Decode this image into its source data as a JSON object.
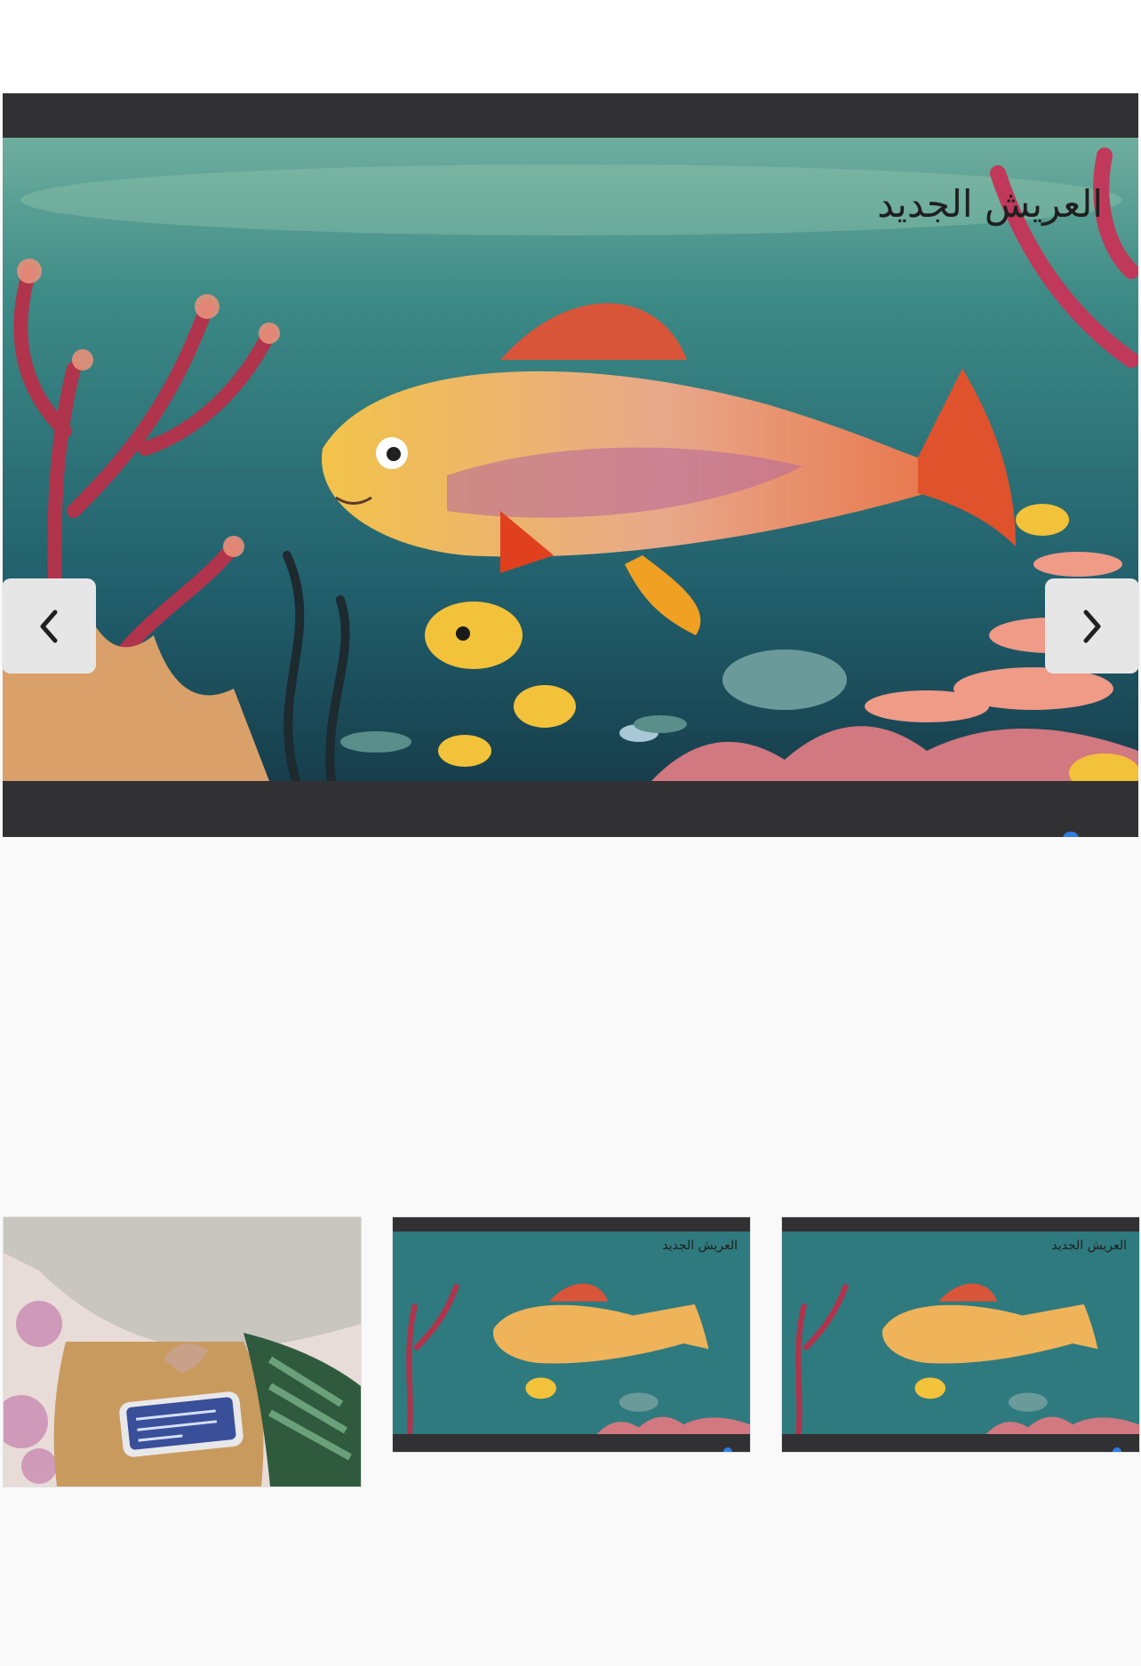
{
  "viewer": {
    "main_caption": "العريش الجديد",
    "prev_icon": "chevron-left-icon",
    "next_icon": "chevron-right-icon"
  },
  "thumbnails": [
    {
      "kind": "photo",
      "subject": "phone-on-table"
    },
    {
      "kind": "illustration",
      "caption": "العريش الجديد"
    },
    {
      "kind": "illustration",
      "caption": "العريش الجديد"
    }
  ],
  "colors": {
    "viewer_frame": "#313133",
    "nav_button": "#e6e6e6",
    "page_background": "#f9f9f9",
    "indicator": "#2f7de1"
  }
}
